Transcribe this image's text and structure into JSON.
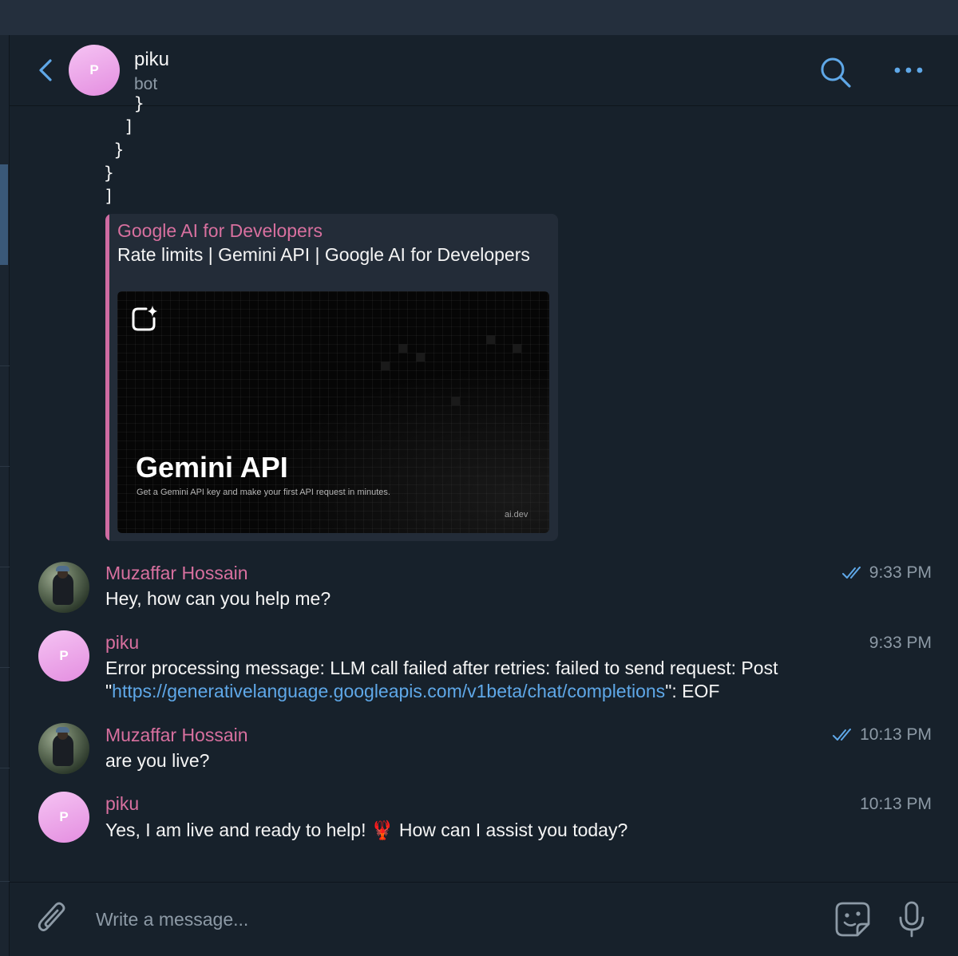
{
  "header": {
    "back_icon": "chevron-left-icon",
    "avatar_letter": "P",
    "name": "piku",
    "subtitle": "bot",
    "search_icon": "search-icon",
    "more_icon": "more-horizontal-icon"
  },
  "code_tail": "   }\n  ]\n }\n}\n]",
  "link_preview": {
    "site": "Google AI for Developers",
    "title": "Rate limits  |  Gemini API  |  Google AI for Developers",
    "image_heading": "Gemini API",
    "image_caption": "Get a Gemini API key and make your first API request in minutes.",
    "image_domain": "ai.dev"
  },
  "messages": [
    {
      "sender": "Muzaffar Hossain",
      "text": "Hey, how can you help me?",
      "time": "9:33 PM",
      "read": true
    },
    {
      "sender": "piku",
      "avatar_letter": "P",
      "text_before": "Error processing message: LLM call failed after retries: failed to send request: Post \"",
      "link": "https://generativelanguage.googleapis.com/v1beta/chat/completions",
      "text_after": "\": EOF",
      "time": "9:33 PM"
    },
    {
      "sender": "Muzaffar Hossain",
      "text": "are you live?",
      "time": "10:13 PM",
      "read": true
    },
    {
      "sender": "piku",
      "avatar_letter": "P",
      "text_before": "Yes, I am live and ready to help! ",
      "emoji": "🦞",
      "text_after": " How can I assist you today?",
      "time": "10:13 PM"
    }
  ],
  "composer": {
    "placeholder": "Write a message...",
    "attach_icon": "paperclip-icon",
    "sticker_icon": "sticker-icon",
    "mic_icon": "microphone-icon"
  },
  "colors": {
    "background": "#17212b",
    "accent_blue": "#5fa8e8",
    "sender_name": "#d8709f",
    "avatar_gradient": "#e48ee0"
  }
}
